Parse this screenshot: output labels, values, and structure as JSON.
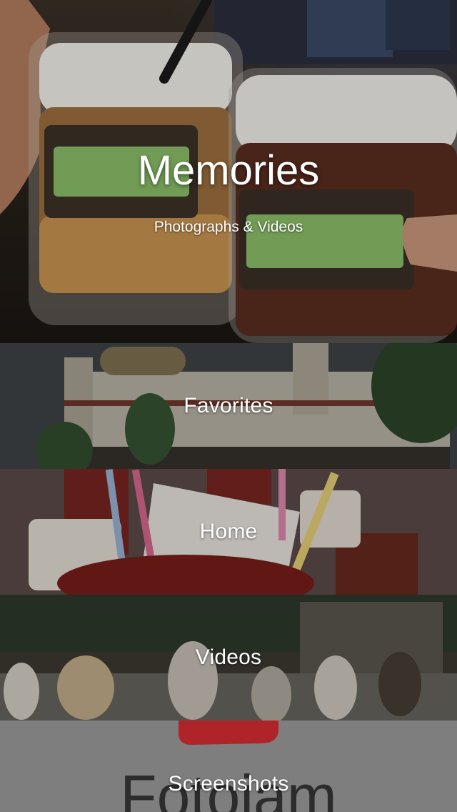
{
  "hero": {
    "title": "Memories",
    "subtitle": "Photographs & Videos"
  },
  "albums": [
    {
      "label": "Favorites"
    },
    {
      "label": "Home"
    },
    {
      "label": "Videos"
    },
    {
      "label": "Screenshots"
    }
  ],
  "screenshots_background_text": "Fotojam",
  "colors": {
    "overlay_text": "#ffffff",
    "screenshots_bg": "#858585",
    "logo_red": "#b8262c",
    "logo_text": "#2f2f2f"
  }
}
